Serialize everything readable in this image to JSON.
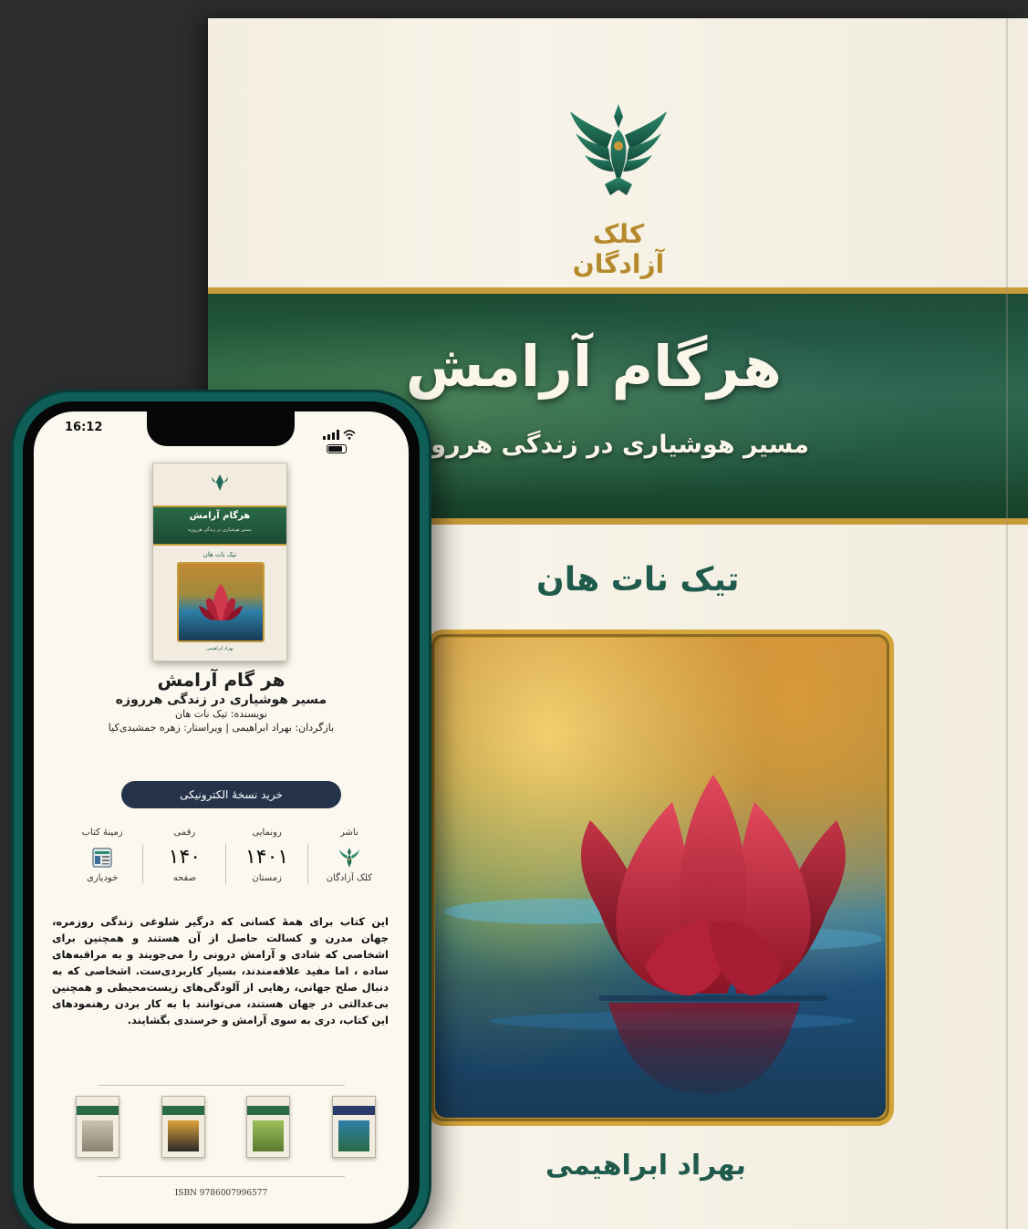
{
  "cover": {
    "publisher_name": "کلک آزادگان",
    "title": "هرگام آرامش",
    "subtitle": "مسیر هوشیاری در زندگی هرروزه",
    "author": "تیک نات هان",
    "translator": "بهراد ابراهیمی",
    "colors": {
      "band": "#1f5138",
      "gold": "#c79b3a",
      "author_text": "#1f5a4c"
    }
  },
  "phone": {
    "status_time": "16:12",
    "book": {
      "title": "هر گام آرامش",
      "subtitle": "مسیر هوشیاری در زندگی هرروزه",
      "author_line": "نویسنده: تیک نات هان",
      "credits_line": "بازگردان: بهراد ابراهیمی | ویراستار: زهره جمشیدی‌کیا"
    },
    "buy_button": "خرید نسخهٔ الکترونیکی",
    "stats": [
      {
        "label": "ناشر",
        "value": "",
        "footer": "کلک آزادگان",
        "icon": "publisher-logo-icon"
      },
      {
        "label": "رونمایی",
        "value": "۱۴۰۱",
        "footer": "زمستان"
      },
      {
        "label": "رقمی",
        "value": "۱۴۰",
        "footer": "صفحه"
      },
      {
        "label": "زمینهٔ کتاب",
        "value": "",
        "footer": "خودیاری",
        "icon": "category-icon"
      }
    ],
    "description": "این کتاب برای همهٔ کسانی که درگیر شلوغی زندگی روزمره، جهان مدرن و کسالت حاصل از آن هستند و همچنین برای اشخاصی که شادی و آرامش درونی را می‌جویند و به مراقبه‌های ساده ، اما مفید علاقه‌مندند، بسیار کاربردی‌ست. اشخاصی که به دنبال صلح جهانی، رهایی از آلودگی‌های زیست‌محیطی و همچنین بی‌عدالتی در جهان هستند، می‌توانند با به کار بردن رهنمودهای این کتاب، دری به سوی آرامش و خرسندی بگشایند.",
    "related_books": [
      {
        "band": "#2a6a47",
        "image": "#a09a86"
      },
      {
        "band": "#2a6a47",
        "image": "#8a6a40"
      },
      {
        "band": "#2a6a47",
        "image": "#7a9a50"
      },
      {
        "band": "#2a3a6a",
        "image": "#2d7fa8"
      }
    ],
    "isbn": "ISBN 9786007996577"
  }
}
